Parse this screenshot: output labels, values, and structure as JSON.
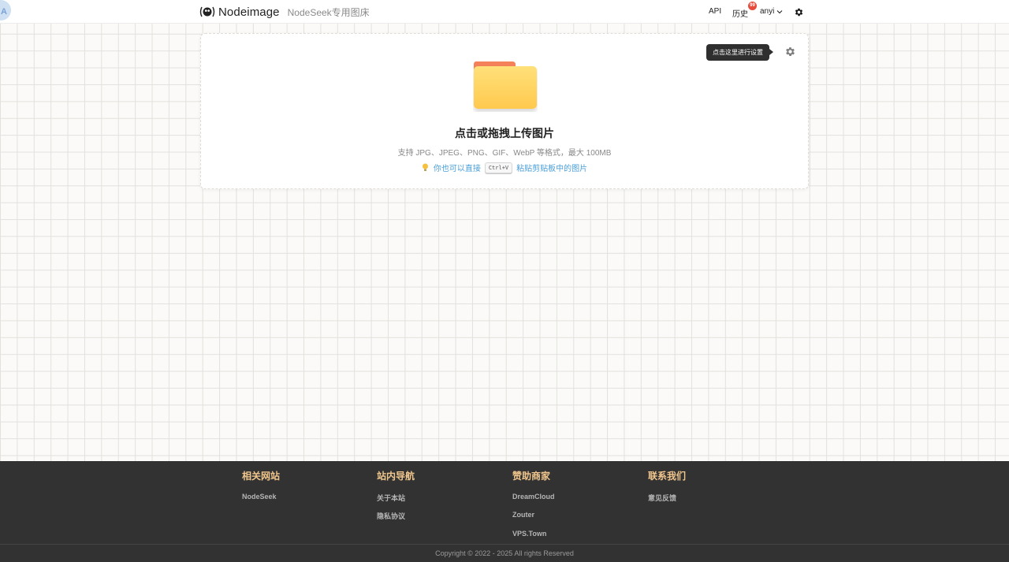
{
  "header": {
    "avatar_letter": "A",
    "logo_text": "Nodeimage",
    "logo_sub": "NodeSeek专用图床",
    "nav": {
      "api": "API",
      "history": "历史",
      "history_badge": "99",
      "user": "anyi"
    }
  },
  "upload": {
    "title": "点击或拖拽上传图片",
    "description": "支持 JPG、JPEG、PNG、GIF、WebP 等格式，最大 100MB",
    "hint_prefix": "你也可以直接",
    "hint_key": "Ctrl+V",
    "hint_suffix": "粘贴剪贴板中的图片",
    "tooltip": "点击这里进行设置"
  },
  "footer": {
    "columns": [
      {
        "title": "相关网站",
        "links": [
          "NodeSeek"
        ]
      },
      {
        "title": "站内导航",
        "links": [
          "关于本站",
          "隐私协议"
        ]
      },
      {
        "title": "赞助商家",
        "links": [
          "DreamCloud",
          "Zouter",
          "VPS.Town"
        ]
      },
      {
        "title": "联系我们",
        "links": [
          "意见反馈"
        ]
      }
    ],
    "copyright": "Copyright © 2022 - 2025 All rights Reserved"
  },
  "colors": {
    "accent_link": "#4a9fd8",
    "footer_heading": "#f0c68d",
    "badge": "#e64b3c",
    "folder_front": "#ffd25e",
    "folder_tab": "#f4815a"
  },
  "icons": [
    "logo-eye-icon",
    "chevron-down-icon",
    "gear-icon",
    "folder-icon",
    "lightbulb-icon",
    "settings-gear-icon"
  ]
}
